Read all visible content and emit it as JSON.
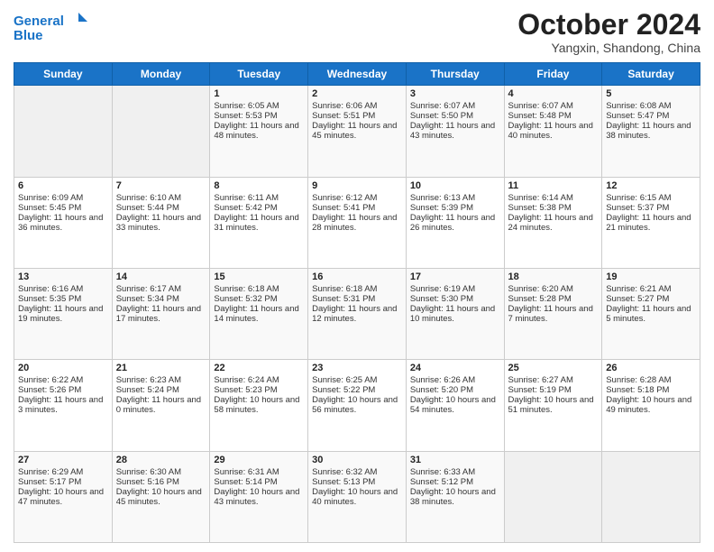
{
  "header": {
    "logo": {
      "line1": "General",
      "line2": "Blue"
    },
    "title": "October 2024",
    "subtitle": "Yangxin, Shandong, China"
  },
  "weekdays": [
    "Sunday",
    "Monday",
    "Tuesday",
    "Wednesday",
    "Thursday",
    "Friday",
    "Saturday"
  ],
  "weeks": [
    [
      {
        "day": "",
        "empty": true
      },
      {
        "day": "",
        "empty": true
      },
      {
        "day": "1",
        "sunrise": "Sunrise: 6:05 AM",
        "sunset": "Sunset: 5:53 PM",
        "daylight": "Daylight: 11 hours and 48 minutes."
      },
      {
        "day": "2",
        "sunrise": "Sunrise: 6:06 AM",
        "sunset": "Sunset: 5:51 PM",
        "daylight": "Daylight: 11 hours and 45 minutes."
      },
      {
        "day": "3",
        "sunrise": "Sunrise: 6:07 AM",
        "sunset": "Sunset: 5:50 PM",
        "daylight": "Daylight: 11 hours and 43 minutes."
      },
      {
        "day": "4",
        "sunrise": "Sunrise: 6:07 AM",
        "sunset": "Sunset: 5:48 PM",
        "daylight": "Daylight: 11 hours and 40 minutes."
      },
      {
        "day": "5",
        "sunrise": "Sunrise: 6:08 AM",
        "sunset": "Sunset: 5:47 PM",
        "daylight": "Daylight: 11 hours and 38 minutes."
      }
    ],
    [
      {
        "day": "6",
        "sunrise": "Sunrise: 6:09 AM",
        "sunset": "Sunset: 5:45 PM",
        "daylight": "Daylight: 11 hours and 36 minutes."
      },
      {
        "day": "7",
        "sunrise": "Sunrise: 6:10 AM",
        "sunset": "Sunset: 5:44 PM",
        "daylight": "Daylight: 11 hours and 33 minutes."
      },
      {
        "day": "8",
        "sunrise": "Sunrise: 6:11 AM",
        "sunset": "Sunset: 5:42 PM",
        "daylight": "Daylight: 11 hours and 31 minutes."
      },
      {
        "day": "9",
        "sunrise": "Sunrise: 6:12 AM",
        "sunset": "Sunset: 5:41 PM",
        "daylight": "Daylight: 11 hours and 28 minutes."
      },
      {
        "day": "10",
        "sunrise": "Sunrise: 6:13 AM",
        "sunset": "Sunset: 5:39 PM",
        "daylight": "Daylight: 11 hours and 26 minutes."
      },
      {
        "day": "11",
        "sunrise": "Sunrise: 6:14 AM",
        "sunset": "Sunset: 5:38 PM",
        "daylight": "Daylight: 11 hours and 24 minutes."
      },
      {
        "day": "12",
        "sunrise": "Sunrise: 6:15 AM",
        "sunset": "Sunset: 5:37 PM",
        "daylight": "Daylight: 11 hours and 21 minutes."
      }
    ],
    [
      {
        "day": "13",
        "sunrise": "Sunrise: 6:16 AM",
        "sunset": "Sunset: 5:35 PM",
        "daylight": "Daylight: 11 hours and 19 minutes."
      },
      {
        "day": "14",
        "sunrise": "Sunrise: 6:17 AM",
        "sunset": "Sunset: 5:34 PM",
        "daylight": "Daylight: 11 hours and 17 minutes."
      },
      {
        "day": "15",
        "sunrise": "Sunrise: 6:18 AM",
        "sunset": "Sunset: 5:32 PM",
        "daylight": "Daylight: 11 hours and 14 minutes."
      },
      {
        "day": "16",
        "sunrise": "Sunrise: 6:18 AM",
        "sunset": "Sunset: 5:31 PM",
        "daylight": "Daylight: 11 hours and 12 minutes."
      },
      {
        "day": "17",
        "sunrise": "Sunrise: 6:19 AM",
        "sunset": "Sunset: 5:30 PM",
        "daylight": "Daylight: 11 hours and 10 minutes."
      },
      {
        "day": "18",
        "sunrise": "Sunrise: 6:20 AM",
        "sunset": "Sunset: 5:28 PM",
        "daylight": "Daylight: 11 hours and 7 minutes."
      },
      {
        "day": "19",
        "sunrise": "Sunrise: 6:21 AM",
        "sunset": "Sunset: 5:27 PM",
        "daylight": "Daylight: 11 hours and 5 minutes."
      }
    ],
    [
      {
        "day": "20",
        "sunrise": "Sunrise: 6:22 AM",
        "sunset": "Sunset: 5:26 PM",
        "daylight": "Daylight: 11 hours and 3 minutes."
      },
      {
        "day": "21",
        "sunrise": "Sunrise: 6:23 AM",
        "sunset": "Sunset: 5:24 PM",
        "daylight": "Daylight: 11 hours and 0 minutes."
      },
      {
        "day": "22",
        "sunrise": "Sunrise: 6:24 AM",
        "sunset": "Sunset: 5:23 PM",
        "daylight": "Daylight: 10 hours and 58 minutes."
      },
      {
        "day": "23",
        "sunrise": "Sunrise: 6:25 AM",
        "sunset": "Sunset: 5:22 PM",
        "daylight": "Daylight: 10 hours and 56 minutes."
      },
      {
        "day": "24",
        "sunrise": "Sunrise: 6:26 AM",
        "sunset": "Sunset: 5:20 PM",
        "daylight": "Daylight: 10 hours and 54 minutes."
      },
      {
        "day": "25",
        "sunrise": "Sunrise: 6:27 AM",
        "sunset": "Sunset: 5:19 PM",
        "daylight": "Daylight: 10 hours and 51 minutes."
      },
      {
        "day": "26",
        "sunrise": "Sunrise: 6:28 AM",
        "sunset": "Sunset: 5:18 PM",
        "daylight": "Daylight: 10 hours and 49 minutes."
      }
    ],
    [
      {
        "day": "27",
        "sunrise": "Sunrise: 6:29 AM",
        "sunset": "Sunset: 5:17 PM",
        "daylight": "Daylight: 10 hours and 47 minutes."
      },
      {
        "day": "28",
        "sunrise": "Sunrise: 6:30 AM",
        "sunset": "Sunset: 5:16 PM",
        "daylight": "Daylight: 10 hours and 45 minutes."
      },
      {
        "day": "29",
        "sunrise": "Sunrise: 6:31 AM",
        "sunset": "Sunset: 5:14 PM",
        "daylight": "Daylight: 10 hours and 43 minutes."
      },
      {
        "day": "30",
        "sunrise": "Sunrise: 6:32 AM",
        "sunset": "Sunset: 5:13 PM",
        "daylight": "Daylight: 10 hours and 40 minutes."
      },
      {
        "day": "31",
        "sunrise": "Sunrise: 6:33 AM",
        "sunset": "Sunset: 5:12 PM",
        "daylight": "Daylight: 10 hours and 38 minutes."
      },
      {
        "day": "",
        "empty": true
      },
      {
        "day": "",
        "empty": true
      }
    ]
  ]
}
